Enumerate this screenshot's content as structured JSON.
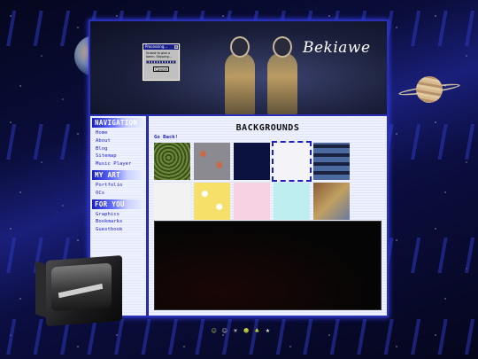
{
  "banner": {
    "site_name": "Bekiawe"
  },
  "dialog": {
    "title": "Processing...",
    "close": "x",
    "message": "Unable to give a damn. Skipping...",
    "button": "Cancel"
  },
  "sidebar": {
    "sections": [
      {
        "heading": "NAVIGATION",
        "items": [
          "Home",
          "About",
          "Blog",
          "Sitemap",
          "Music Player"
        ]
      },
      {
        "heading": "MY ART",
        "items": [
          "Portfolio",
          "OCs"
        ]
      },
      {
        "heading": "FOR YOU",
        "items": [
          "Graphics",
          "Bookmarks",
          "Guestbook"
        ]
      }
    ]
  },
  "main": {
    "title": "BACKGROUNDS",
    "go_back": "Go Back!",
    "tiles": [
      {
        "name": "green-moss",
        "color": "#4f6a2a",
        "selected": false
      },
      {
        "name": "floral-gray",
        "color": "#8a8a90",
        "selected": false
      },
      {
        "name": "dark-blue-texture",
        "color": "#0c1240",
        "selected": false
      },
      {
        "name": "blank-white",
        "color": "#f4f4f8",
        "selected": true
      },
      {
        "name": "eyes-collage",
        "color": "#30385a",
        "selected": false
      },
      {
        "name": "white-paper",
        "color": "#f2f2f2",
        "selected": false
      },
      {
        "name": "yellow-stars",
        "color": "#f6e06a",
        "selected": false
      },
      {
        "name": "pink-pastel",
        "color": "#f7d2e2",
        "selected": false
      },
      {
        "name": "cyan-pastel",
        "color": "#bfeef0",
        "selected": false
      },
      {
        "name": "cd-rainbow",
        "color": "#b07a5a",
        "selected": false
      }
    ]
  },
  "footer": {
    "badges": [
      {
        "icon": "alien-face-icon",
        "glyph": "☺",
        "color": "#b0c060"
      },
      {
        "icon": "alien-face-icon",
        "glyph": "☺",
        "color": "#d0d0d0"
      },
      {
        "icon": "lightbulb-icon",
        "glyph": "☀",
        "color": "#e8e8e8"
      },
      {
        "icon": "ghost-icon",
        "glyph": "☻",
        "color": "#d8e040"
      },
      {
        "icon": "leaf-icon",
        "glyph": "♣",
        "color": "#c8e030"
      },
      {
        "icon": "star-icon",
        "glyph": "★",
        "color": "#e0e0e0"
      }
    ]
  }
}
